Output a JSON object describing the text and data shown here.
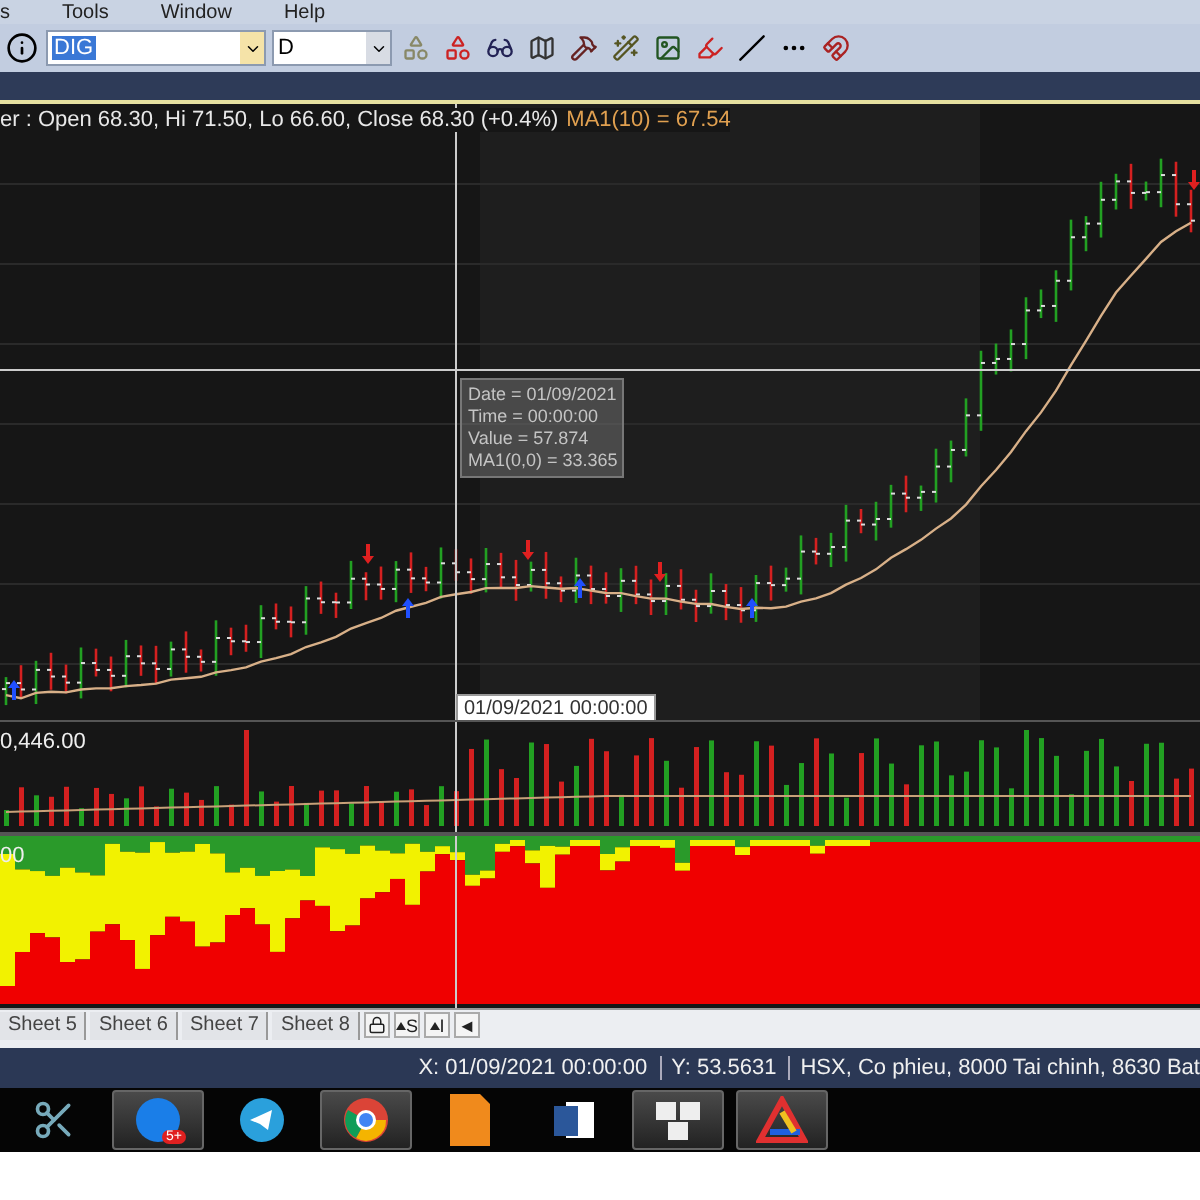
{
  "menu": [
    {
      "label": "s"
    },
    {
      "label": "Tools"
    },
    {
      "label": "Window"
    },
    {
      "label": "Help"
    }
  ],
  "toolbar": {
    "symbol": "DIG",
    "period": "D"
  },
  "chart": {
    "header": "er : Open 68.30, Hi 71.50, Lo 66.60, Close 68.30 (+0.4%)",
    "ma_label": "MA1(10) = 67.54",
    "tooltip": [
      "Date = 01/09/2021",
      "Time = 00:00:00",
      "Value = 57.874",
      "MA1(0,0) = 33.365"
    ],
    "date_label": "01/09/2021 00:00:00"
  },
  "volume": {
    "label": "0,446.00"
  },
  "indicator": {
    "label": "00"
  },
  "sheets": [
    {
      "label": "Sheet 5",
      "selected": false
    },
    {
      "label": "Sheet 6",
      "selected": false
    },
    {
      "label": "Sheet 7",
      "selected": false
    },
    {
      "label": "Sheet 8",
      "selected": false
    }
  ],
  "sheet_buttons": [
    {
      "kind": "lock"
    },
    {
      "kind": "sort",
      "label": "S"
    },
    {
      "kind": "sort",
      "label": "I"
    },
    {
      "kind": "text",
      "label": "◄"
    }
  ],
  "status": [
    "X: 01/09/2021 00:00:00",
    "Y: 53.5631",
    "HSX, Co phieu, 8000 Tai chinh, 8630 Bat"
  ],
  "taskbar": [
    {
      "kind": "snip",
      "active": false
    },
    {
      "kind": "zalo",
      "badge": "5+",
      "active": true
    },
    {
      "kind": "telegram",
      "active": false
    },
    {
      "kind": "chrome",
      "active": true
    },
    {
      "kind": "pdf",
      "active": false
    },
    {
      "kind": "word",
      "active": false
    },
    {
      "kind": "tiles",
      "active": true
    },
    {
      "kind": "triangle",
      "active": true
    }
  ]
}
